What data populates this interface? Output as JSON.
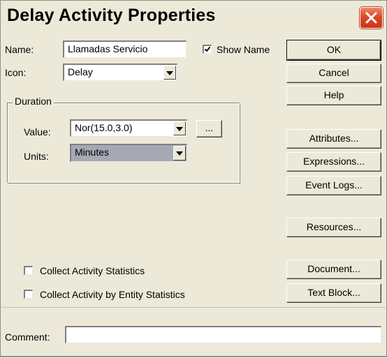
{
  "dialog": {
    "title": "Delay Activity Properties",
    "close_icon": "close-icon",
    "accent": "#d74a26"
  },
  "form": {
    "name_label": "Name:",
    "name_value": "Llamadas Servicio",
    "show_name_label": "Show Name",
    "show_name_checked": true,
    "icon_label": "Icon:",
    "icon_value": "Delay",
    "duration_group": "Duration",
    "value_label": "Value:",
    "value_value": "Nor(15.0,3.0)",
    "ellipsis_label": "...",
    "units_label": "Units:",
    "units_value": "Minutes",
    "collect_activity_stats_label": "Collect Activity Statistics",
    "collect_activity_stats_checked": false,
    "collect_entity_stats_label": "Collect Activity by Entity Statistics",
    "collect_entity_stats_checked": false,
    "comment_label": "Comment:",
    "comment_value": ""
  },
  "buttons": {
    "ok": "OK",
    "cancel": "Cancel",
    "help": "Help",
    "attributes": "Attributes...",
    "expressions": "Expressions...",
    "event_logs": "Event Logs...",
    "resources": "Resources...",
    "document": "Document...",
    "text_block": "Text Block..."
  }
}
